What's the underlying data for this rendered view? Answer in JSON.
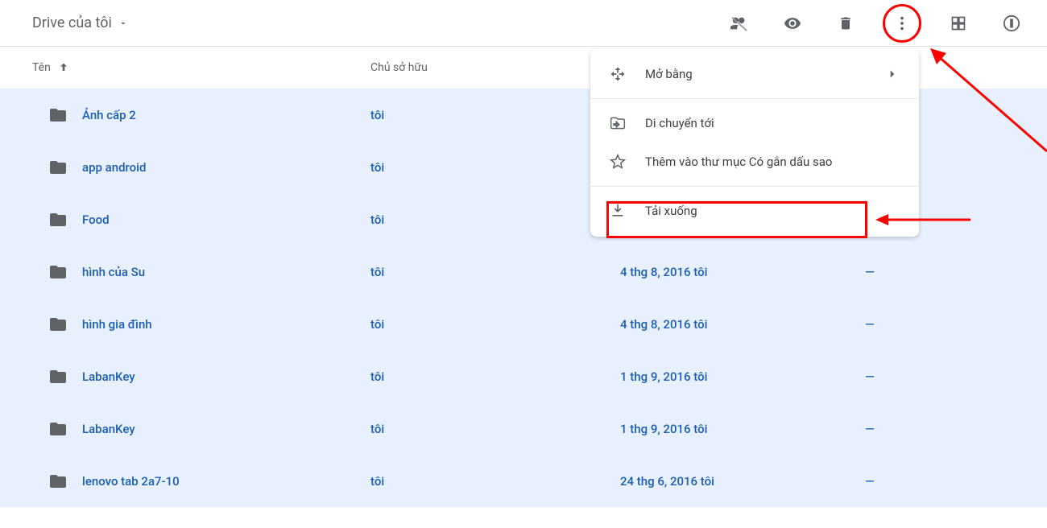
{
  "breadcrumb": {
    "title": "Drive của tôi"
  },
  "headers": {
    "name": "Tên",
    "owner": "Chủ sở hữu",
    "modified": "",
    "size": ""
  },
  "rows": [
    {
      "name": "Ảnh cấp 2",
      "owner": "tôi",
      "modified": "",
      "size": ""
    },
    {
      "name": "app android",
      "owner": "tôi",
      "modified": "",
      "size": ""
    },
    {
      "name": "Food",
      "owner": "tôi",
      "modified": "",
      "size": ""
    },
    {
      "name": "hình của Su",
      "owner": "tôi",
      "modified": "4 thg 8, 2016 tôi",
      "size": "—"
    },
    {
      "name": "hình gia đình",
      "owner": "tôi",
      "modified": "4 thg 8, 2016 tôi",
      "size": "—"
    },
    {
      "name": "LabanKey",
      "owner": "tôi",
      "modified": "1 thg 9, 2016 tôi",
      "size": "—"
    },
    {
      "name": "LabanKey",
      "owner": "tôi",
      "modified": "1 thg 9, 2016 tôi",
      "size": "—"
    },
    {
      "name": "lenovo tab 2a7-10",
      "owner": "tôi",
      "modified": "24 thg 6, 2016 tôi",
      "size": "—"
    }
  ],
  "menu": {
    "open_with": "Mở bằng",
    "move_to": "Di chuyển tới",
    "add_star": "Thêm vào thư mục Có gắn dấu sao",
    "download": "Tải xuống"
  }
}
